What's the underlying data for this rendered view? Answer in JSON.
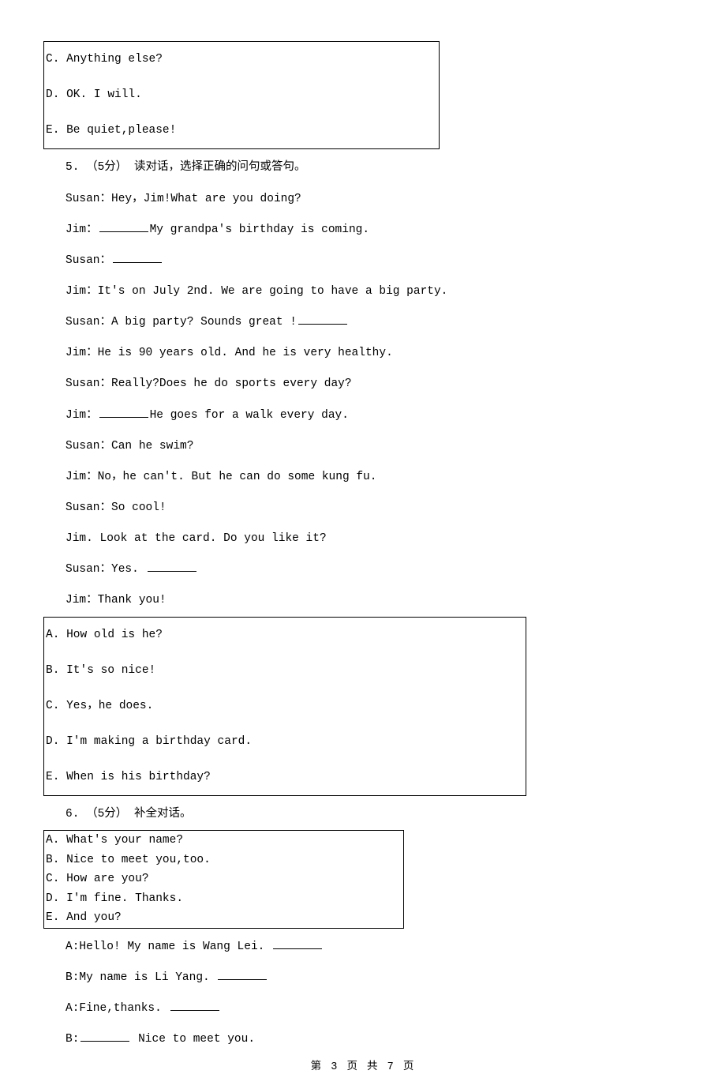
{
  "box1": {
    "c": "C. Anything else?",
    "d": "D. OK. I will.",
    "e": "E. Be quiet,please!"
  },
  "q5": {
    "header": "5. （5分） 读对话，选择正确的问句或答句。",
    "l1a": "Susan：Hey，Jim!What are you doing?",
    "l2a": "Jim：",
    "l2b": "My grandpa's birthday is coming.",
    "l3a": "Susan：",
    "l4": "Jim：It's on July 2nd. We are going to have a big party.",
    "l5a": "Susan：A big party? Sounds great !",
    "l6": "Jim：He is 90 years old. And he is very healthy.",
    "l7": "Susan：Really?Does he do sports every day?",
    "l8a": "Jim：",
    "l8b": "He goes for a walk every day.",
    "l9": "Susan：Can he swim?",
    "l10": "Jim：No，he can't. But he can do some kung fu.",
    "l11": "Susan：So cool!",
    "l12": "Jim. Look at the card. Do you like it?",
    "l13a": "Susan：Yes. ",
    "l14": "Jim：Thank you!"
  },
  "box2": {
    "a": "A. How old is he?",
    "b": "B. It's so nice!",
    "c": "C. Yes，he does.",
    "d": "D. I'm making a birthday card.",
    "e": "E. When is his birthday?"
  },
  "q6": {
    "header": "6. （5分） 补全对话。"
  },
  "box3": {
    "a": "A. What's your name?",
    "b": "B. Nice to meet you,too.",
    "c": "C. How are you?",
    "d": "D. I'm fine. Thanks.",
    "e": "E. And you?"
  },
  "q6body": {
    "l1a": "A:Hello! My name is Wang Lei. ",
    "l2a": "B:My name is Li Yang. ",
    "l3a": "A:Fine,thanks. ",
    "l4a": "B:",
    "l4b": " Nice to meet you."
  },
  "footer": "第 3 页 共 7 页"
}
